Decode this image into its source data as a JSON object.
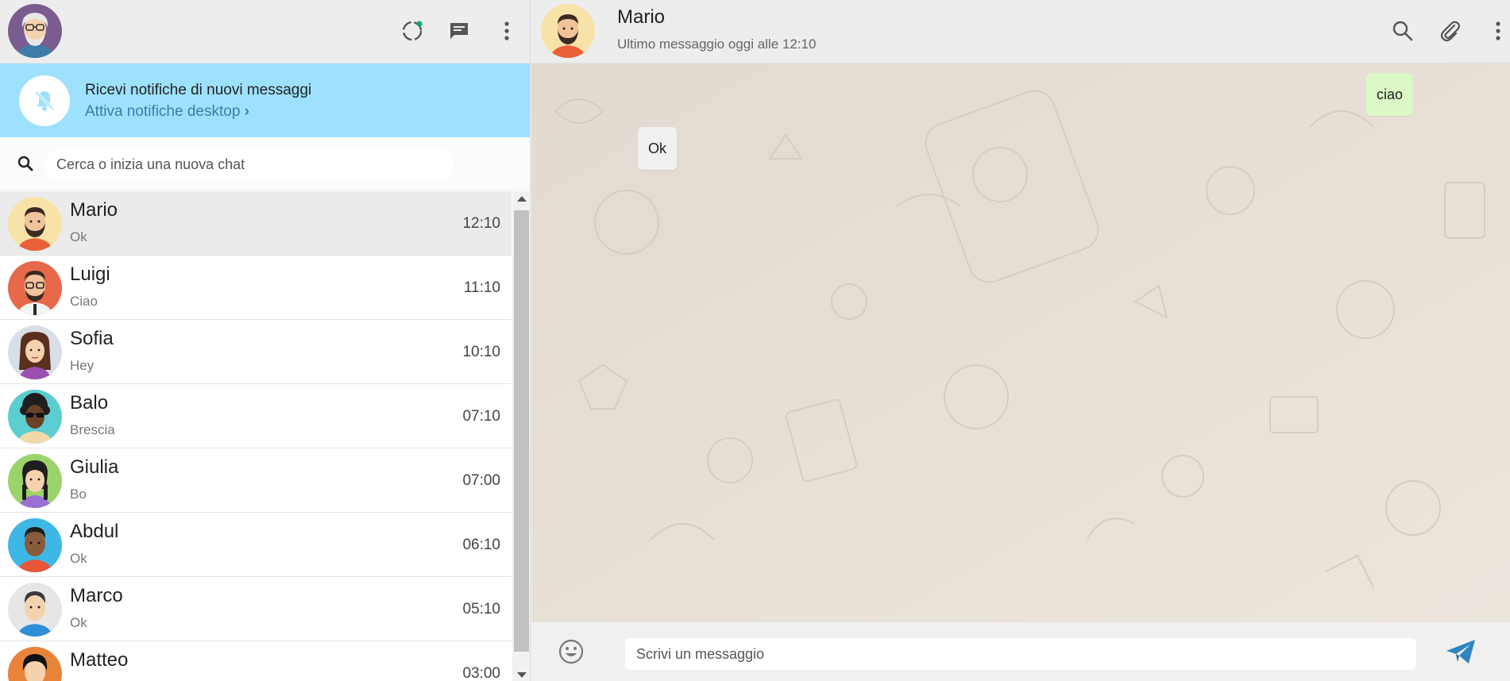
{
  "colors": {
    "notification_bg": "#9de1fe",
    "link": "#3a7fa3",
    "outgoing_bubble": "#dcf8c6",
    "incoming_bubble": "#f0f0f0",
    "send_icon": "#2e86c1",
    "status_dot": "#00a884"
  },
  "sidebar": {
    "header_icons": [
      "status-icon",
      "new-chat-icon",
      "menu-dots-icon"
    ]
  },
  "notification": {
    "icon": "bell-off-icon",
    "title": "Ricevi notifiche di nuovi messaggi",
    "link": "Attiva notifiche desktop"
  },
  "search": {
    "icon": "search-icon",
    "placeholder": "Cerca o inizia una nuova chat",
    "value": ""
  },
  "chats": [
    {
      "name": "Mario",
      "last": "Ok",
      "time": "12:10",
      "active": true,
      "avatar": "man-beard-avatar"
    },
    {
      "name": "Luigi",
      "last": "Ciao",
      "time": "11:10",
      "active": false,
      "avatar": "man-glasses-avatar"
    },
    {
      "name": "Sofia",
      "last": "Hey",
      "time": "10:10",
      "active": false,
      "avatar": "woman-avatar"
    },
    {
      "name": "Balo",
      "last": "Brescia",
      "time": "07:10",
      "active": false,
      "avatar": "man-sunglasses-avatar"
    },
    {
      "name": "Giulia",
      "last": "Bo",
      "time": "07:00",
      "active": false,
      "avatar": "woman-braids-avatar"
    },
    {
      "name": "Abdul",
      "last": "Ok",
      "time": "06:10",
      "active": false,
      "avatar": "man-dark-avatar"
    },
    {
      "name": "Marco",
      "last": "Ok",
      "time": "05:10",
      "active": false,
      "avatar": "man-avatar"
    },
    {
      "name": "Matteo",
      "last": "",
      "time": "03:00",
      "active": false,
      "avatar": "man-black-hair-avatar"
    }
  ],
  "conversation": {
    "contact_name": "Mario",
    "status": "Ultimo messaggio oggi alle 12:10",
    "header_icons": [
      "search-icon",
      "attach-icon",
      "menu-dots-icon"
    ],
    "messages": [
      {
        "text": "ciao",
        "direction": "out"
      },
      {
        "text": "Ok",
        "direction": "in"
      }
    ]
  },
  "composer": {
    "placeholder": "Scrivi un messaggio",
    "value": "",
    "emoji_icon": "emoji-icon",
    "send_icon": "send-icon"
  }
}
